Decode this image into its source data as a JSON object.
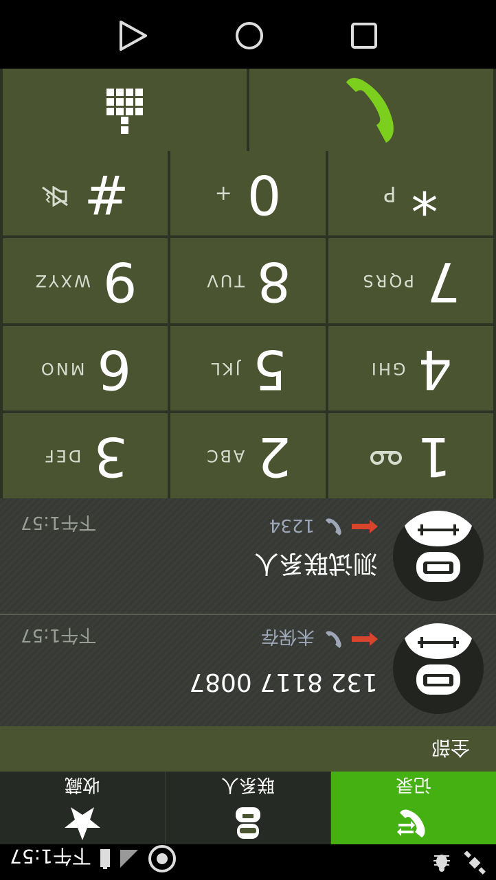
{
  "status_bar": {
    "time": "下午1:57",
    "icons": [
      "satellite-icon",
      "debug-icon",
      "sync-icon",
      "signal-icon",
      "battery-icon"
    ]
  },
  "tabs": [
    {
      "label": "记录",
      "icon": "call-log-icon",
      "active": true
    },
    {
      "label": "联系人",
      "icon": "contacts-icon",
      "active": false
    },
    {
      "label": "收藏",
      "icon": "star-icon",
      "active": false
    }
  ],
  "filter": {
    "label": "全部"
  },
  "call_log": [
    {
      "name": "132 8117 0087",
      "status": "未保存",
      "time": "下午1:57"
    },
    {
      "name": "测试联系人",
      "status": "1234",
      "time": "下午1:57"
    }
  ],
  "keypad": {
    "keys": [
      {
        "digit": "1",
        "letters": ""
      },
      {
        "digit": "2",
        "letters": "ABC"
      },
      {
        "digit": "3",
        "letters": "DEF"
      },
      {
        "digit": "4",
        "letters": "GHI"
      },
      {
        "digit": "5",
        "letters": "JKL"
      },
      {
        "digit": "6",
        "letters": "MNO"
      },
      {
        "digit": "7",
        "letters": "PQRS"
      },
      {
        "digit": "8",
        "letters": "TUV"
      },
      {
        "digit": "9",
        "letters": "WXYZ"
      },
      {
        "digit": "*",
        "letters": "P"
      },
      {
        "digit": "0",
        "letters": "+"
      },
      {
        "digit": "#",
        "letters": ""
      }
    ]
  },
  "colors": {
    "accent": "#44b012",
    "key_bg": "#4a5431",
    "call_green": "#7ccf1c",
    "missed_red": "#d8442c"
  }
}
